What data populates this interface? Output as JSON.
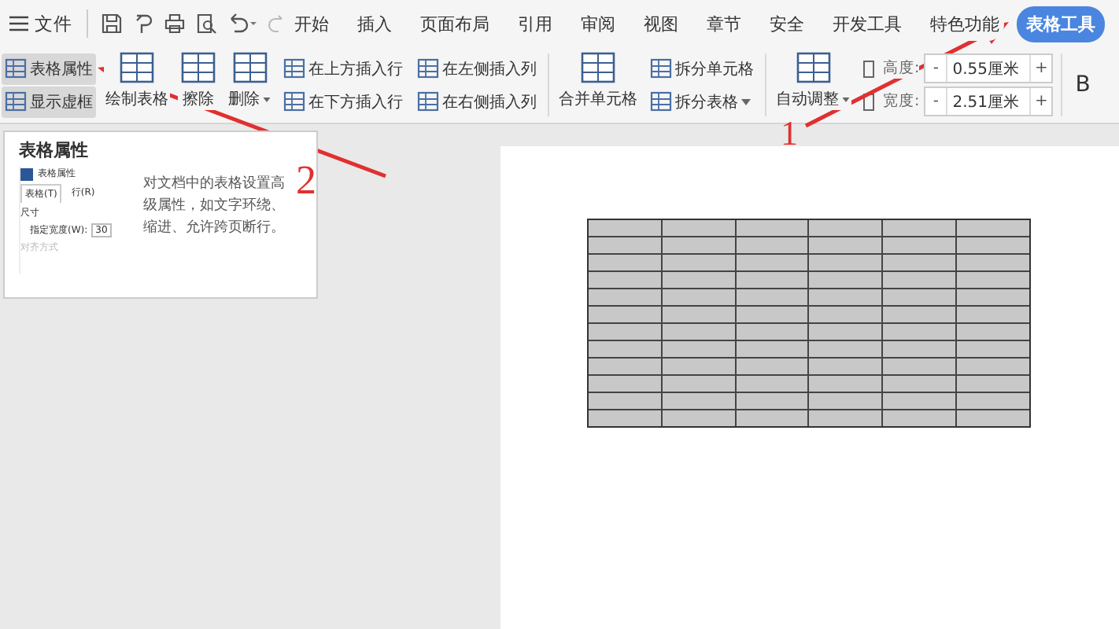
{
  "menu": {
    "file_label": "文件",
    "tabs": [
      {
        "label": "开始",
        "selected": false
      },
      {
        "label": "插入",
        "selected": false
      },
      {
        "label": "页面布局",
        "selected": false
      },
      {
        "label": "引用",
        "selected": false
      },
      {
        "label": "审阅",
        "selected": false
      },
      {
        "label": "视图",
        "selected": false
      },
      {
        "label": "章节",
        "selected": false
      },
      {
        "label": "安全",
        "selected": false
      },
      {
        "label": "开发工具",
        "selected": false
      },
      {
        "label": "特色功能",
        "selected": false
      },
      {
        "label": "表格工具",
        "selected": true
      }
    ]
  },
  "ribbon": {
    "columns": [
      {
        "kind": "stack",
        "items": [
          {
            "label": "表格属性",
            "selected": true,
            "dropdown": false
          },
          {
            "label": "显示虚框",
            "selected": true,
            "dropdown": false
          }
        ]
      },
      {
        "kind": "large",
        "label": "绘制表格",
        "dropdown": false
      },
      {
        "kind": "large",
        "label": "擦除",
        "dropdown": false
      },
      {
        "kind": "large",
        "label": "删除",
        "dropdown": true
      },
      {
        "kind": "stack",
        "items": [
          {
            "label": "在上方插入行",
            "selected": false,
            "dropdown": false
          },
          {
            "label": "在下方插入行",
            "selected": false,
            "dropdown": false
          }
        ]
      },
      {
        "kind": "stack",
        "items": [
          {
            "label": "在左侧插入列",
            "selected": false,
            "dropdown": false
          },
          {
            "label": "在右侧插入列",
            "selected": false,
            "dropdown": false
          }
        ]
      },
      {
        "kind": "separator"
      },
      {
        "kind": "large",
        "label": "合并单元格",
        "dropdown": false
      },
      {
        "kind": "stack",
        "items": [
          {
            "label": "拆分单元格",
            "selected": false,
            "dropdown": false
          },
          {
            "label": "拆分表格",
            "selected": false,
            "dropdown": true
          }
        ]
      },
      {
        "kind": "separator"
      },
      {
        "kind": "large",
        "label": "自动调整",
        "dropdown": true
      },
      {
        "kind": "size",
        "fields": [
          {
            "label": "高度:",
            "minus": "-",
            "value": "0.55厘米",
            "plus": "+"
          },
          {
            "label": "宽度:",
            "minus": "-",
            "value": "2.51厘米",
            "plus": "+"
          }
        ]
      },
      {
        "kind": "separator"
      },
      {
        "kind": "font",
        "label": "B"
      }
    ]
  },
  "tooltip": {
    "title": "表格属性",
    "preview": {
      "title": "表格属性",
      "tabs": [
        {
          "label": "表格(T)",
          "selected": true
        },
        {
          "label": "行(R)",
          "selected": false
        }
      ],
      "section": "尺寸",
      "field_label": "指定宽度(W):",
      "field_value": "30",
      "faded_section": "对齐方式"
    },
    "description": "对文档中的表格设置高级属性，如文字环绕、缩进、允许跨页断行。"
  },
  "annotations": [
    {
      "label": "1"
    },
    {
      "label": "2"
    }
  ]
}
